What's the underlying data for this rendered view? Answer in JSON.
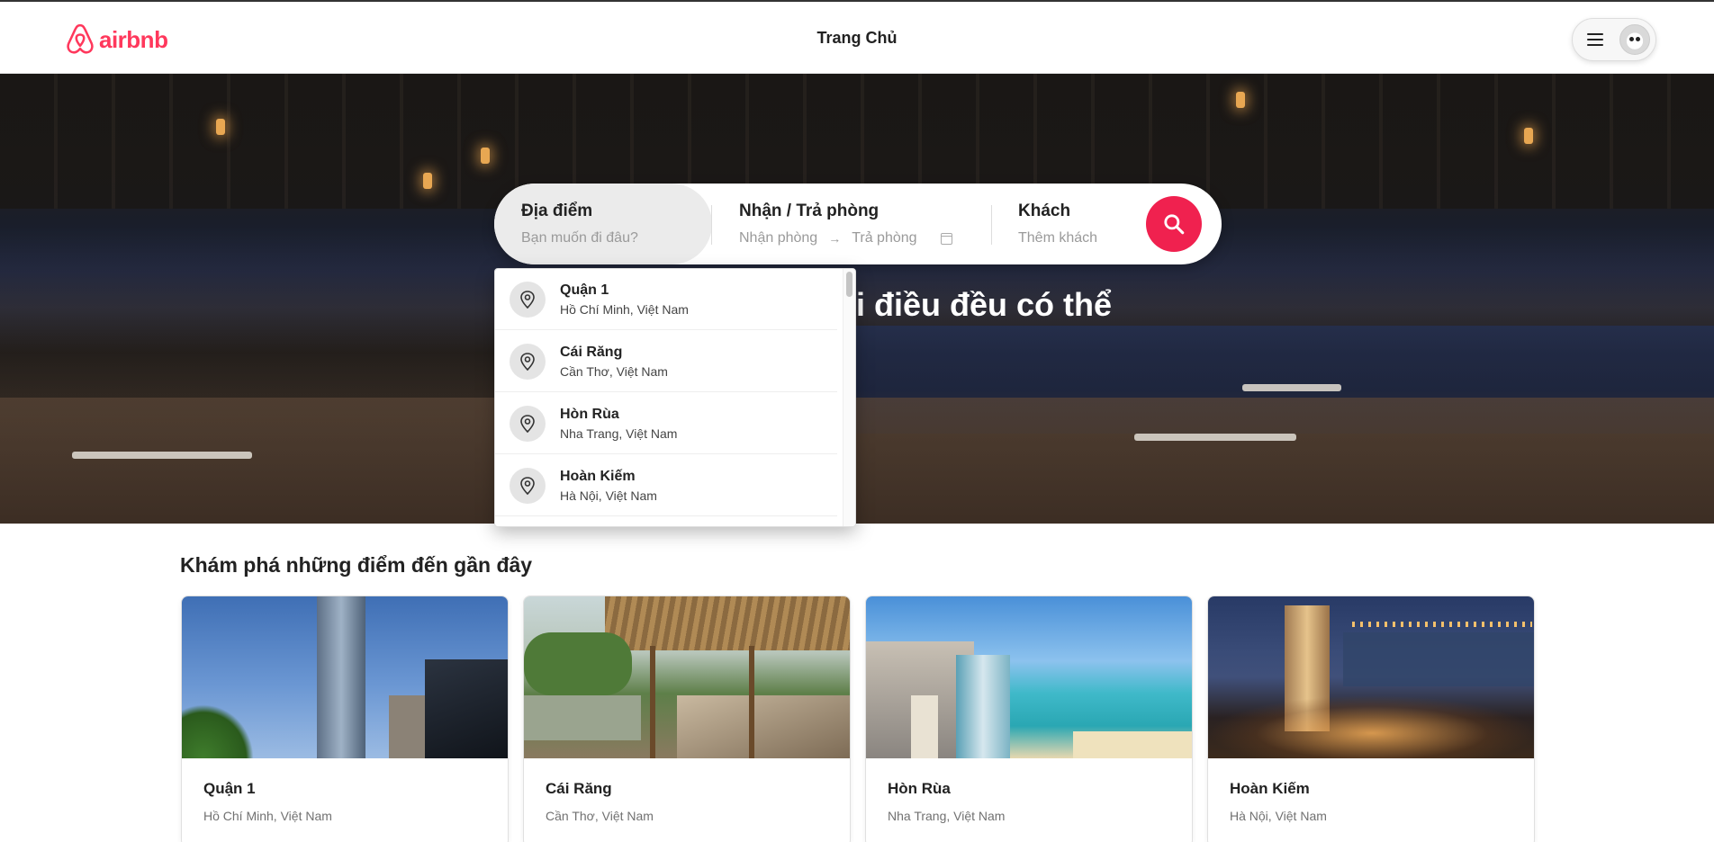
{
  "header": {
    "brand": "airbnb",
    "nav_title": "Trang Chủ",
    "logo_icon": "airbnb-logo-icon",
    "menu_icon": "hamburger-icon",
    "avatar_icon": "user-avatar"
  },
  "hero": {
    "heading": "i điều đều có thể"
  },
  "search": {
    "location_label": "Địa điểm",
    "location_placeholder": "Bạn muốn đi đâu?",
    "dates_label": "Nhận / Trả phòng",
    "checkin_placeholder": "Nhận phòng",
    "checkout_placeholder": "Trả phòng",
    "arrow": "→",
    "guests_label": "Khách",
    "guests_placeholder": "Thêm khách",
    "button_icon": "search-icon"
  },
  "suggestions": [
    {
      "title": "Quận 1",
      "subtitle": "Hồ Chí Minh, Việt Nam"
    },
    {
      "title": "Cái Răng",
      "subtitle": "Cần Thơ, Việt Nam"
    },
    {
      "title": "Hòn Rùa",
      "subtitle": "Nha Trang, Việt Nam"
    },
    {
      "title": "Hoàn Kiếm",
      "subtitle": "Hà Nội, Việt Nam"
    }
  ],
  "explore": {
    "title": "Khám phá những điểm đến gần đây",
    "cards": [
      {
        "title": "Quận 1",
        "subtitle": "Hồ Chí Minh, Việt Nam"
      },
      {
        "title": "Cái Răng",
        "subtitle": "Cần Thơ, Việt Nam"
      },
      {
        "title": "Hòn Rùa",
        "subtitle": "Nha Trang, Việt Nam"
      },
      {
        "title": "Hoàn Kiếm",
        "subtitle": "Hà Nội, Việt Nam"
      }
    ]
  },
  "colors": {
    "brand": "#ff385c",
    "search_button": "#f0214f"
  }
}
